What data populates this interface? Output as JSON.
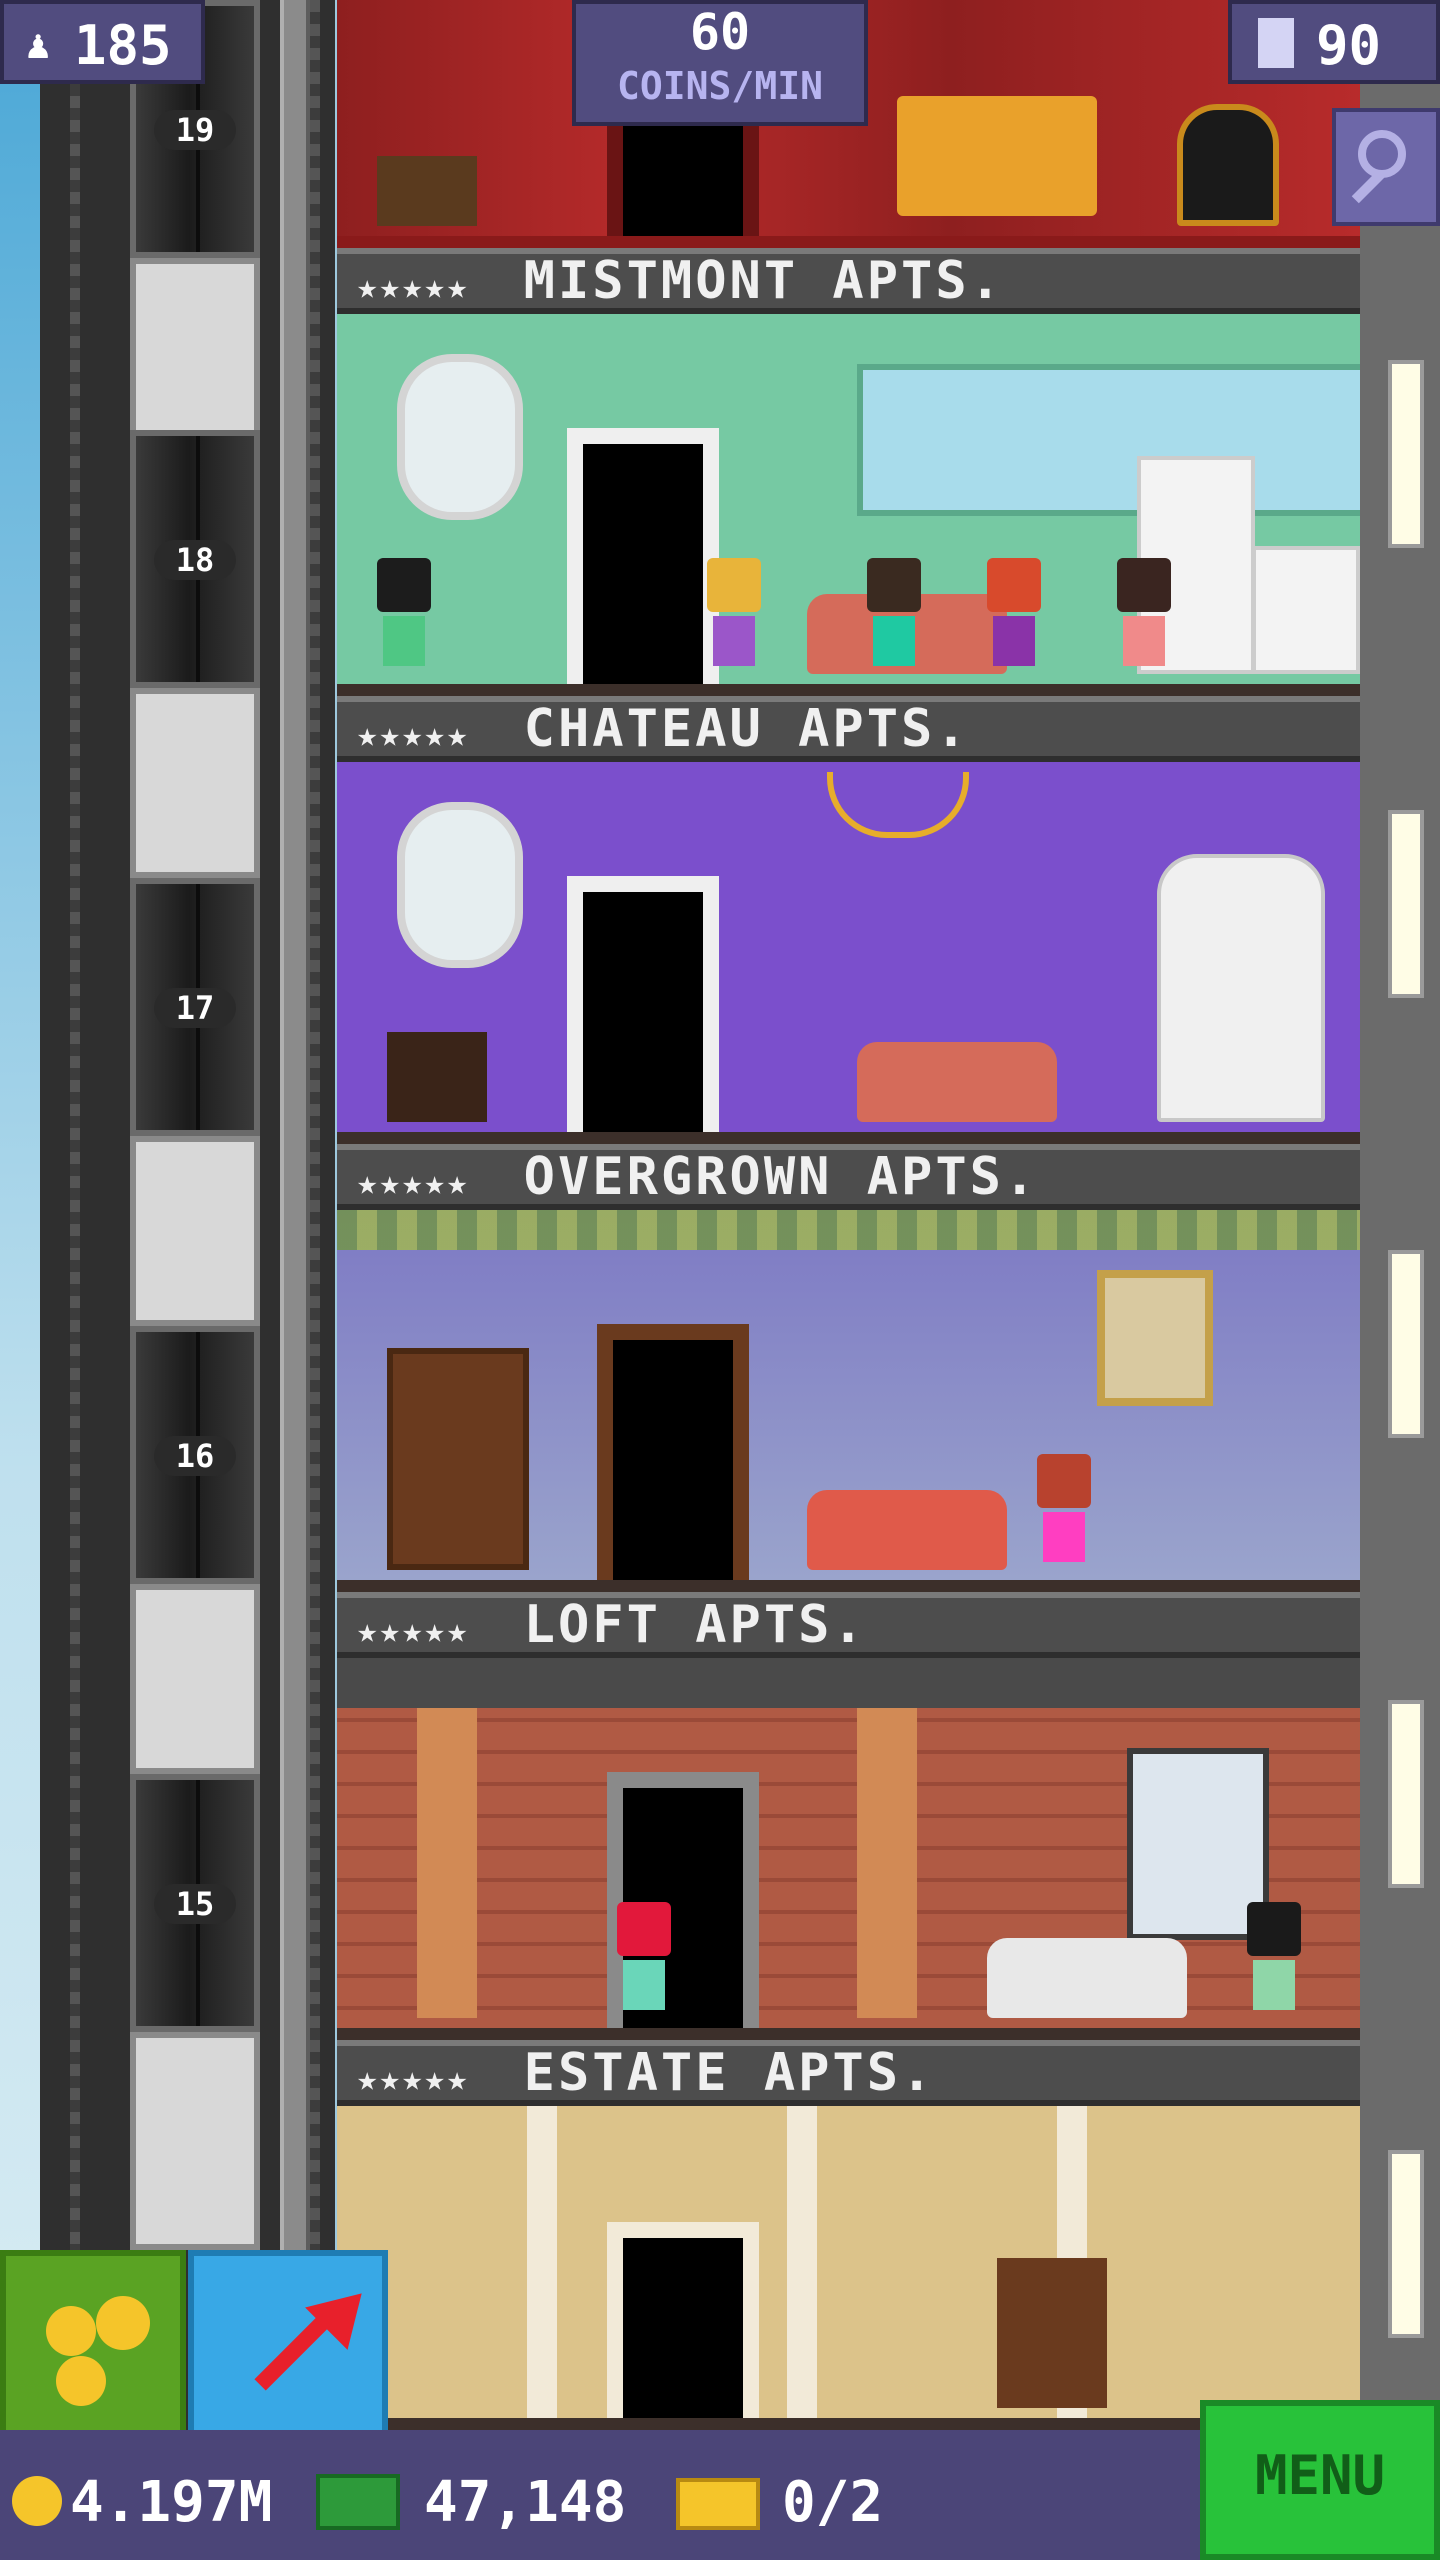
{
  "hud": {
    "population": "185",
    "coins_rate_value": "60",
    "coins_rate_unit": "COINS/MIN",
    "floors": "90",
    "zoom_icon": "magnifier-icon",
    "population_icon": "person-icon",
    "floors_icon": "building-icon"
  },
  "elevator": {
    "floor_labels": [
      "19",
      "18",
      "17",
      "16",
      "15"
    ]
  },
  "floors": [
    {
      "name": "MISTMONT APTS.",
      "stars": "★★★★★"
    },
    {
      "name": "CHATEAU APTS.",
      "stars": "★★★★★"
    },
    {
      "name": "OVERGROWN APTS.",
      "stars": "★★★★★"
    },
    {
      "name": "LOFT APTS.",
      "stars": "★★★★★"
    },
    {
      "name": "ESTATE APTS.",
      "stars": "★★★★★"
    }
  ],
  "bottom": {
    "coins": "4.197M",
    "bux": "47,148",
    "tickets": "0/2",
    "menu_label": "MENU",
    "coins_icon": "coin-icon",
    "bux_icon": "bux-icon",
    "ticket_icon": "ticket-icon"
  },
  "colors": {
    "hud_bg": "#514c7f",
    "menu_green": "#28c23a",
    "coin_button": "#5aa323",
    "bitizen_button": "#38a8e6"
  }
}
